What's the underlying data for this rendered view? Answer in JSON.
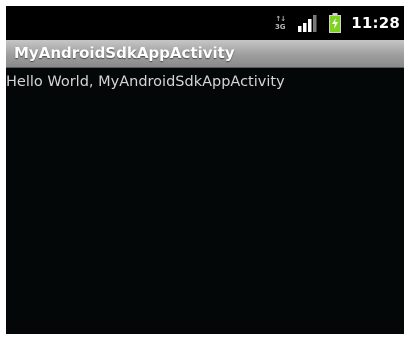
{
  "status_bar": {
    "network_type": "3G",
    "clock": "11:28",
    "icons": [
      "3g-data-icon",
      "signal-strength-icon",
      "battery-charging-icon"
    ],
    "colors": {
      "signal": "#ffffff",
      "battery": "#7ed321"
    }
  },
  "app_bar": {
    "title": "MyAndroidSdkAppActivity",
    "background": "#9e9e9e"
  },
  "content": {
    "text": "Hello World, MyAndroidSdkAppActivity"
  },
  "theme": {
    "background": "#030707",
    "text_color": "#d6d6d6"
  }
}
